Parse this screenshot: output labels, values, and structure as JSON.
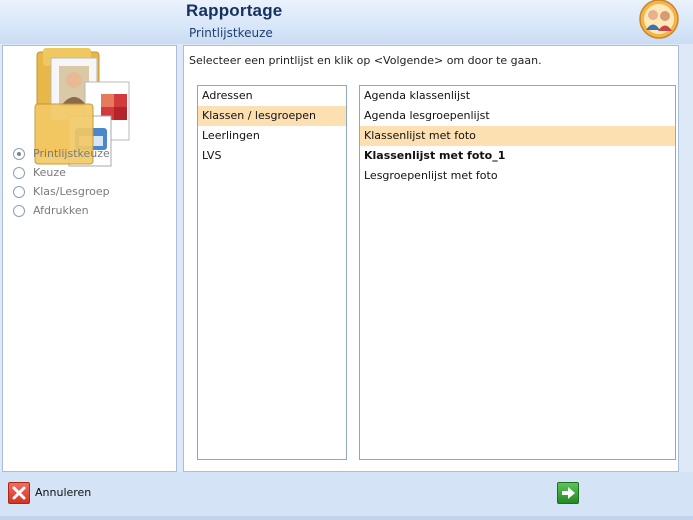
{
  "header": {
    "title": "Rapportage",
    "subtitle": "Printlijstkeuze",
    "help_icon": "users-help-icon",
    "folder_icon": "folder-documents-icon"
  },
  "steps": [
    {
      "label": "Printlijstkeuze",
      "checked": true
    },
    {
      "label": "Keuze",
      "checked": false
    },
    {
      "label": "Klas/Lesgroep",
      "checked": false
    },
    {
      "label": "Afdrukken",
      "checked": false
    }
  ],
  "main": {
    "instruction": "Selecteer een printlijst en klik op <Volgende> om door te gaan.",
    "categories": [
      "Adressen",
      "Klassen / lesgroepen",
      "Leerlingen",
      "LVS"
    ],
    "selected_category": "Klassen / lesgroepen",
    "printlists": [
      "Agenda klassenlijst",
      "Agenda lesgroepenlijst",
      "Klassenlijst met foto",
      "Klassenlijst met foto_1",
      "Lesgroepenlijst met foto"
    ],
    "selected_printlist": "Klassenlijst met foto",
    "bold_printlist": "Klassenlijst met foto_1"
  },
  "footer": {
    "cancel_label": "Annuleren",
    "cancel_icon": "close-x-icon",
    "next_icon": "arrow-right-icon"
  },
  "colors": {
    "selection": "#fde0b2",
    "title": "#15325e",
    "cancel_red": "#d53322",
    "next_green": "#238a22"
  }
}
